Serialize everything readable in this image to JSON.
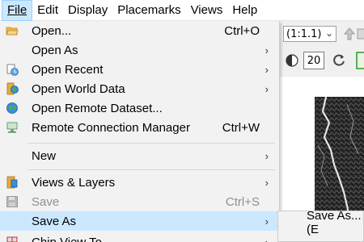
{
  "menubar": {
    "file": "File",
    "edit": "Edit",
    "display": "Display",
    "placemarks": "Placemarks",
    "views": "Views",
    "help": "Help"
  },
  "toolbar": {
    "zoom_value": "(1:1.1)",
    "contrast_value": "20"
  },
  "file_menu": {
    "open": {
      "label": "Open...",
      "shortcut": "Ctrl+O"
    },
    "open_as": {
      "label": "Open As"
    },
    "open_recent": {
      "label": "Open Recent"
    },
    "open_world_data": {
      "label": "Open World Data"
    },
    "open_remote_dataset": {
      "label": "Open Remote Dataset..."
    },
    "remote_connection_manager": {
      "label": "Remote Connection Manager",
      "shortcut": "Ctrl+W"
    },
    "new": {
      "label": "New"
    },
    "views_layers": {
      "label": "Views & Layers"
    },
    "save": {
      "label": "Save",
      "shortcut": "Ctrl+S"
    },
    "save_as": {
      "label": "Save As"
    },
    "chip_view_to": {
      "label": "Chip View To"
    }
  },
  "save_as_submenu": {
    "save_as": {
      "label": "Save As... (E"
    }
  },
  "colors": {
    "highlight": "#cce8ff",
    "highlight_border": "#99d1ff",
    "menu_bg": "#f2f2f2",
    "disabled_text": "#8f8f8f"
  }
}
